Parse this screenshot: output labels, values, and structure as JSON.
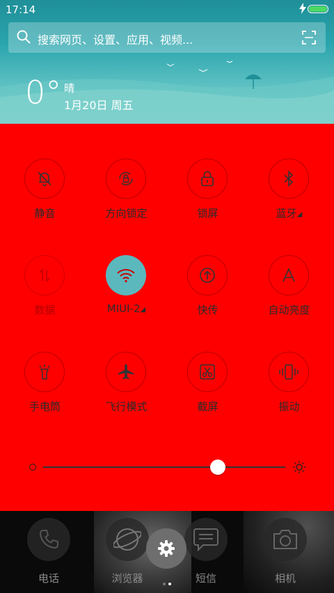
{
  "status_bar": {
    "time": "17:14",
    "icons": [
      "charging-bolt-icon",
      "battery-icon"
    ]
  },
  "search": {
    "placeholder": "搜索网页、设置、应用、视频..."
  },
  "weather": {
    "temperature": "0°",
    "condition": "晴",
    "date": "1月20日 周五"
  },
  "toggles": [
    {
      "label": "静音",
      "icon": "bell-off-icon",
      "state": "off"
    },
    {
      "label": "方向锁定",
      "icon": "rotation-lock-icon",
      "state": "off"
    },
    {
      "label": "锁屏",
      "icon": "lock-icon",
      "state": "off"
    },
    {
      "label": "蓝牙",
      "icon": "bluetooth-icon",
      "state": "off",
      "expandable": true
    },
    {
      "label": "数据",
      "icon": "mobile-data-icon",
      "state": "disabled"
    },
    {
      "label": "MIUI-2",
      "icon": "wifi-icon",
      "state": "on",
      "expandable": true
    },
    {
      "label": "快传",
      "icon": "share-upload-icon",
      "state": "off"
    },
    {
      "label": "自动亮度",
      "icon": "auto-brightness-icon",
      "state": "off"
    },
    {
      "label": "手电筒",
      "icon": "flashlight-icon",
      "state": "off"
    },
    {
      "label": "飞行模式",
      "icon": "airplane-icon",
      "state": "off"
    },
    {
      "label": "截屏",
      "icon": "screenshot-scissors-icon",
      "state": "off"
    },
    {
      "label": "振动",
      "icon": "vibrate-icon",
      "state": "off"
    }
  ],
  "brightness": {
    "level": 0.72
  },
  "dock": {
    "apps": [
      {
        "label": "电话",
        "icon": "phone-icon"
      },
      {
        "label": "浏览器",
        "icon": "browser-globe-icon"
      },
      {
        "label": "短信",
        "icon": "message-icon"
      },
      {
        "label": "相机",
        "icon": "camera-icon"
      }
    ],
    "settings_icon": "gear-icon",
    "pages": 2,
    "current_page": 2
  },
  "colors": {
    "panel_bg": "#ff0000",
    "active_toggle": "#5bb8bd",
    "header_top": "#1f8f98",
    "header_bottom": "#7ccfca"
  }
}
